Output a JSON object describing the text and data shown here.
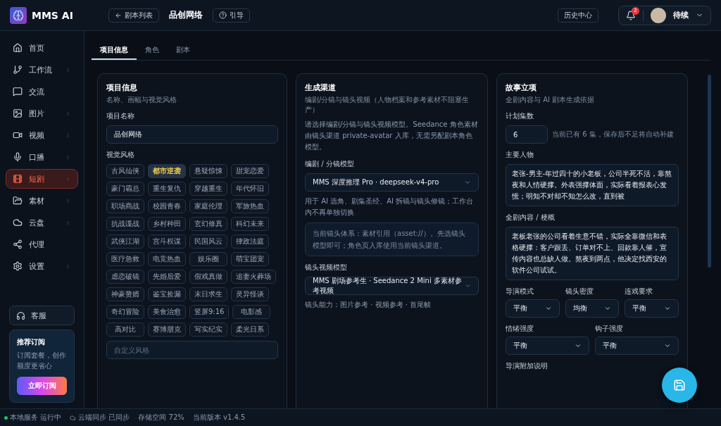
{
  "header": {
    "brand": "MMS AI",
    "back_button": "剧本列表",
    "project_title": "品创网络",
    "guide_button": "引导",
    "history_button": "历史中心",
    "notification_count": "2",
    "user_name": "待续"
  },
  "sidebar": {
    "items": [
      {
        "label": "首页",
        "has_submenu": false,
        "selected": false
      },
      {
        "label": "工作流",
        "has_submenu": true,
        "selected": false
      },
      {
        "label": "交流",
        "has_submenu": false,
        "selected": false
      },
      {
        "label": "图片",
        "has_submenu": true,
        "selected": false
      },
      {
        "label": "视频",
        "has_submenu": true,
        "selected": false
      },
      {
        "label": "口播",
        "has_submenu": true,
        "selected": false
      },
      {
        "label": "短剧",
        "has_submenu": true,
        "selected": true
      },
      {
        "label": "素材",
        "has_submenu": true,
        "selected": false
      },
      {
        "label": "云盘",
        "has_submenu": true,
        "selected": false
      },
      {
        "label": "代理",
        "has_submenu": false,
        "selected": false
      },
      {
        "label": "设置",
        "has_submenu": true,
        "selected": false
      }
    ],
    "support_button": "客服",
    "promo": {
      "title": "推荐订阅",
      "text": "订阅套餐，创作额度更省心",
      "button": "立即订阅"
    }
  },
  "tabs": [
    {
      "label": "项目信息",
      "selected": true
    },
    {
      "label": "角色",
      "selected": false
    },
    {
      "label": "剧本",
      "selected": false
    }
  ],
  "project_card": {
    "title": "项目信息",
    "subtitle": "名称、画幅与视觉风格",
    "name_label": "项目名称",
    "name_value": "品创网络",
    "style_label": "视觉风格",
    "styles": [
      {
        "label": "古风仙侠",
        "selected": false
      },
      {
        "label": "都市逆袭",
        "selected": true
      },
      {
        "label": "悬疑惊悚",
        "selected": false
      },
      {
        "label": "甜宠恋爱",
        "selected": false
      },
      {
        "label": "豪门霸总",
        "selected": false
      },
      {
        "label": "重生复仇",
        "selected": false
      },
      {
        "label": "穿越重生",
        "selected": false
      },
      {
        "label": "年代怀旧",
        "selected": false
      },
      {
        "label": "职场商战",
        "selected": false
      },
      {
        "label": "校园青春",
        "selected": false
      },
      {
        "label": "家庭伦理",
        "selected": false
      },
      {
        "label": "军旅热血",
        "selected": false
      },
      {
        "label": "抗战谍战",
        "selected": false
      },
      {
        "label": "乡村种田",
        "selected": false
      },
      {
        "label": "玄幻修真",
        "selected": false
      },
      {
        "label": "科幻未来",
        "selected": false
      },
      {
        "label": "武侠江湖",
        "selected": false
      },
      {
        "label": "宫斗权谋",
        "selected": false
      },
      {
        "label": "民国风云",
        "selected": false
      },
      {
        "label": "律政法庭",
        "selected": false
      },
      {
        "label": "医疗急救",
        "selected": false
      },
      {
        "label": "电竞热血",
        "selected": false
      },
      {
        "label": "娱乐圈",
        "selected": false
      },
      {
        "label": "萌宝团宠",
        "selected": false
      },
      {
        "label": "虐恋破镜",
        "selected": false
      },
      {
        "label": "先婚后爱",
        "selected": false
      },
      {
        "label": "假戏真做",
        "selected": false
      },
      {
        "label": "追妻火葬场",
        "selected": false
      },
      {
        "label": "神豪赘婿",
        "selected": false
      },
      {
        "label": "鉴宝捡漏",
        "selected": false
      },
      {
        "label": "末日求生",
        "selected": false
      },
      {
        "label": "灵异怪谈",
        "selected": false
      },
      {
        "label": "奇幻冒险",
        "selected": false
      },
      {
        "label": "美食治愈",
        "selected": false
      },
      {
        "label": "竖屏9:16",
        "selected": false
      },
      {
        "label": "电影感",
        "selected": false
      },
      {
        "label": "高对比",
        "selected": false
      },
      {
        "label": "赛博朋克",
        "selected": false
      },
      {
        "label": "写实纪实",
        "selected": false
      },
      {
        "label": "柔光日系",
        "selected": false
      }
    ],
    "custom_style_placeholder": "自定义风格"
  },
  "channel_card": {
    "title": "生成渠道",
    "subtitle": "编剧/分镜与镜头视频（人物档案和参考素材不阻塞生产）",
    "description": "请选择编剧/分镜与镜头视频模型。Seedance 角色素材由镜头渠道 private-avatar 入库，无需另配剧本角色模型。",
    "script_model_label": "编剧 / 分镜模型",
    "script_model_value": "MMS 深度推理 Pro · deepseek-v4-pro",
    "script_model_help": "用于 AI 选角、剧集圣经、AI 拆镜与镜头修镜；工作台内不再单独切换",
    "info": "当前镜头体系：素材引用（asset://）。先选镜头模型即可；角色页入库使用当前镜头渠道。",
    "video_model_label": "镜头视频模型",
    "video_model_value": "MMS 剧场参考生 · Seedance 2 Mini 多素材参考视频",
    "video_model_help": "镜头能力：图片参考 · 视频参考 · 首尾帧"
  },
  "story_card": {
    "title": "故事立项",
    "subtitle": "全剧内容与 AI 剧本生成依据",
    "episodes_label": "计划集数",
    "episodes_value": "6",
    "episodes_hint": "当前已有 6 集，保存后不足将自动补建",
    "characters_label": "主要人物",
    "characters_text": "老张-男主-年过四十的小老板，公司半死不活，靠熬夜和人情硬撑。外表强撑体面，实际看着报表心发慌；明知不对却不知怎么改，直到被",
    "synopsis_label": "全剧内容 / 梗概",
    "synopsis_text": "老板老张的公司看着生意不错，实际全靠微信和表格硬撑：客户跟丢、订单对不上、回款靠人催，宣传内容也总缺人做。熬夜到两点，他决定找西安的软件公司试试。",
    "selects_row1": [
      {
        "label": "导演模式",
        "value": "平衡"
      },
      {
        "label": "镜头密度",
        "value": "均衡"
      },
      {
        "label": "连戏要求",
        "value": "平衡"
      }
    ],
    "selects_row2": [
      {
        "label": "情绪强度",
        "value": "平衡"
      },
      {
        "label": "钩子强度",
        "value": "平衡"
      }
    ],
    "notes_label": "导演附加说明"
  },
  "status_bar": {
    "service": "本地服务 运行中",
    "sync": "云端同步 已同步",
    "storage": "存储空间 72%",
    "version": "当前版本 v1.4.5"
  }
}
